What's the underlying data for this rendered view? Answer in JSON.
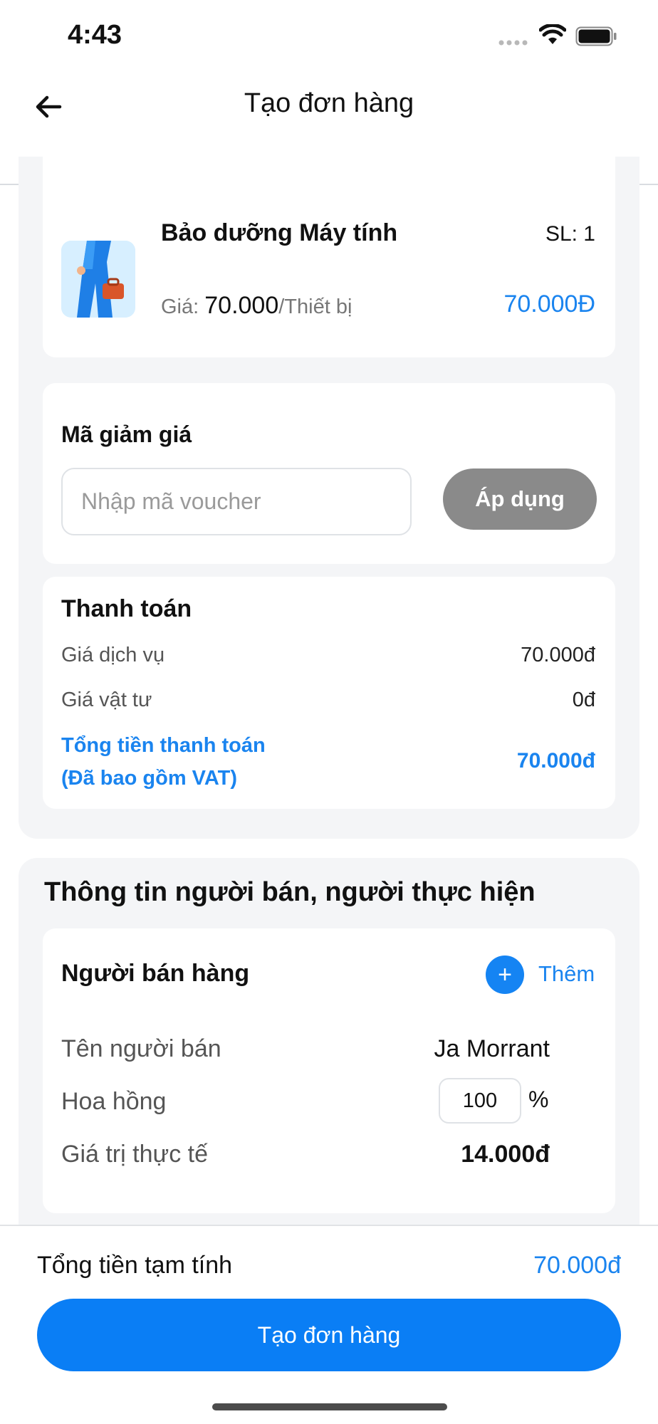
{
  "status_bar": {
    "time": "4:43"
  },
  "header": {
    "title": "Tạo đơn hàng"
  },
  "product": {
    "name": "Bảo dưỡng Máy tính",
    "qty": "SL: 1",
    "price_label": "Giá:",
    "price_value": "70.000",
    "price_unit": "/Thiết bị",
    "total": "70.000Đ"
  },
  "voucher": {
    "title": "Mã giảm giá",
    "placeholder": "Nhập mã voucher",
    "apply_label": "Áp dụng"
  },
  "payment": {
    "title": "Thanh toán",
    "service_label": "Giá dịch vụ",
    "service_value": "70.000đ",
    "material_label": "Giá vật tư",
    "material_value": "0đ",
    "total_label_line1": "Tổng tiền thanh toán",
    "total_label_line2": "(Đã bao gồm VAT)",
    "total_value": "70.000đ"
  },
  "seller_section": {
    "title": "Thông tin người bán, người thực hiện",
    "card_title": "Người bán hàng",
    "add_label": "Thêm",
    "name_label": "Tên người bán",
    "name_value": "Ja Morrant",
    "commission_label": "Hoa hồng",
    "commission_value": "100",
    "percent_sign": "%",
    "actual_label": "Giá trị thực tế",
    "actual_value": "14.000đ"
  },
  "footer": {
    "subtotal_label": "Tổng tiền tạm tính",
    "subtotal_value": "70.000đ",
    "create_label": "Tạo đơn hàng"
  },
  "colors": {
    "accent": "#1a84ef",
    "primary_button": "#0a7ef5",
    "disabled_button": "#8a8a8a",
    "section_bg": "#f4f5f7"
  },
  "icons": [
    "back-arrow-icon",
    "wifi-icon",
    "battery-icon",
    "signal-icon",
    "plus-icon"
  ]
}
